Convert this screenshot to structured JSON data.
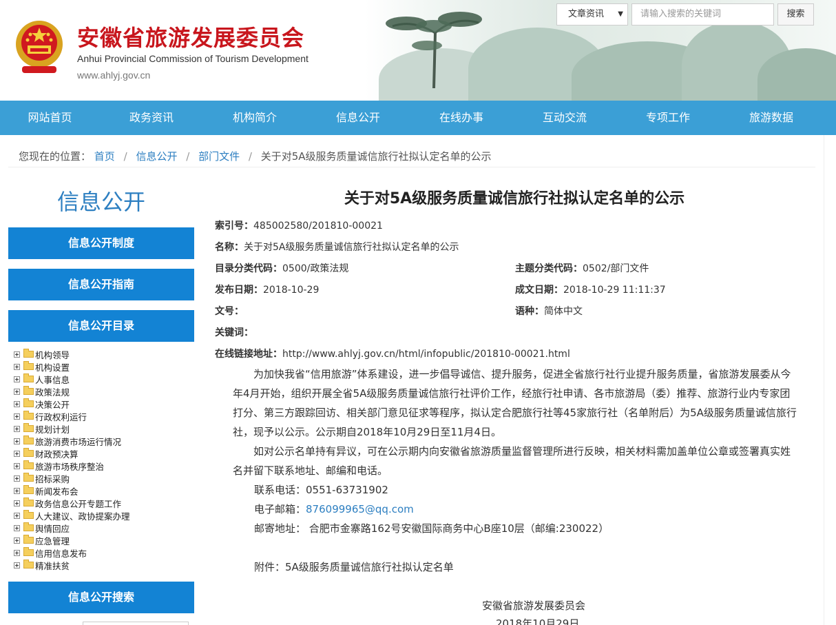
{
  "header": {
    "title_cn": "安徽省旅游发展委员会",
    "title_en": "Anhui Provincial Commission of Tourism Development",
    "url": "www.ahlyj.gov.cn",
    "search_scope": "文章资讯",
    "search_placeholder": "请输入搜索的关键词",
    "search_button": "搜索"
  },
  "nav": [
    "网站首页",
    "政务资讯",
    "机构简介",
    "信息公开",
    "在线办事",
    "互动交流",
    "专项工作",
    "旅游数据"
  ],
  "breadcrumb": {
    "prefix": "您现在的位置：",
    "items": [
      "首页",
      "信息公开",
      "部门文件"
    ],
    "current": "关于对5A级服务质量诚信旅行社拟认定名单的公示"
  },
  "sidebar": {
    "title": "信息公开",
    "buttons": [
      "信息公开制度",
      "信息公开指南",
      "信息公开目录"
    ],
    "tree": [
      "机构领导",
      "机构设置",
      "人事信息",
      "政策法规",
      "决策公开",
      "行政权利运行",
      "规划计划",
      "旅游消费市场运行情况",
      "财政预决算",
      "旅游市场秩序整治",
      "招标采购",
      "新闻发布会",
      "政务信息公开专题工作",
      "人大建议、政协提案办理",
      "舆情回应",
      "应急管理",
      "信用信息发布",
      "精准扶贫"
    ],
    "search_button": "信息公开搜索"
  },
  "article": {
    "title": "关于对5A级服务质量诚信旅行社拟认定名单的公示",
    "meta": {
      "index_label": "索引号：",
      "index": "485002580/201810-00021",
      "name_label": "名称：",
      "name": "关于对5A级服务质量诚信旅行社拟认定名单的公示",
      "catalog_label": "目录分类代码：",
      "catalog": "0500/政策法规",
      "theme_label": "主题分类代码：",
      "theme": "0502/部门文件",
      "pubdate_label": "发布日期：",
      "pubdate": "2018-10-29",
      "createdate_label": "成文日期：",
      "createdate": "2018-10-29 11:11:37",
      "docno_label": "文号：",
      "docno": "",
      "lang_label": "语种：",
      "lang": "简体中文",
      "keywords_label": "关键词：",
      "keywords": "",
      "link_label": "在线链接地址：",
      "link": "http://www.ahlyj.gov.cn/html/infopublic/201810-00021.html"
    },
    "para1": "为加快我省“信用旅游”体系建设，进一步倡导诚信、提升服务，促进全省旅行社行业提升服务质量，省旅游发展委从今年4月开始，组织开展全省5A级服务质量诚信旅行社评价工作，经旅行社申请、各市旅游局（委）推荐、旅游行业内专家团打分、第三方跟踪回访、相关部门意见征求等程序，拟认定合肥旅行社等45家旅行社（名单附后）为5A级服务质量诚信旅行社，现予以公示。公示期自2018年10月29日至11月4日。",
    "para2": "如对公示名单持有异议，可在公示期内向安徽省旅游质量监督管理所进行反映，相关材料需加盖单位公章或签署真实姓名并留下联系地址、邮编和电话。",
    "phone": "联系电话：0551-63731902",
    "email_label": "电子邮箱：",
    "email": "876099965@qq.com",
    "address": "邮寄地址： 合肥市金寨路162号安徽国际商务中心B座10层（邮编:230022）",
    "attachment": "附件：5A级服务质量诚信旅行社拟认定名单",
    "sign": "安徽省旅游发展委员会",
    "date": "2018年10月29日"
  }
}
